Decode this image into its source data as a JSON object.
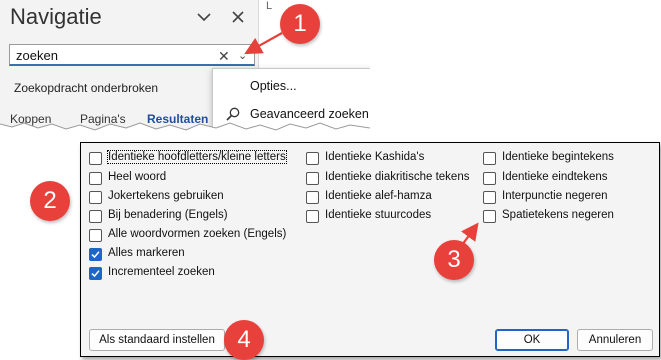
{
  "nav": {
    "title": "Navigatie",
    "ruler_mark": "L",
    "search_value": "zoeken",
    "status": "Zoekopdracht onderbroken",
    "tabs": [
      {
        "label": "Koppen"
      },
      {
        "label": "Pagina's"
      },
      {
        "label": "Resultaten",
        "active": true
      }
    ]
  },
  "menu": {
    "items": [
      {
        "label": "Opties..."
      },
      {
        "label": "Geavanceerd zoeken..."
      }
    ]
  },
  "dialog": {
    "options": [
      {
        "label": "Identieke hoofdletters/kleine letters",
        "checked": false
      },
      {
        "label": "Heel woord",
        "checked": false
      },
      {
        "label": "Jokertekens gebruiken",
        "checked": false
      },
      {
        "label": "Bij benadering (Engels)",
        "checked": false
      },
      {
        "label": "Alle woordvormen zoeken (Engels)",
        "checked": false
      },
      {
        "label": "Alles markeren",
        "checked": true
      },
      {
        "label": "Incrementeel zoeken",
        "checked": true
      },
      {
        "label": "Identieke Kashida's",
        "checked": false
      },
      {
        "label": "Identieke diakritische tekens",
        "checked": false
      },
      {
        "label": "Identieke alef-hamza",
        "checked": false
      },
      {
        "label": "Identieke stuurcodes",
        "checked": false
      },
      {
        "label": "Identieke begintekens",
        "checked": false
      },
      {
        "label": "Identieke eindtekens",
        "checked": false
      },
      {
        "label": "Interpunctie negeren",
        "checked": false
      },
      {
        "label": "Spatietekens negeren",
        "checked": false
      }
    ],
    "set_default_label": "Als standaard instellen",
    "ok_label": "OK",
    "cancel_label": "Annuleren"
  },
  "callouts": [
    "1",
    "2",
    "3",
    "4"
  ],
  "colors": {
    "callout": "#e8403b",
    "checkbox_checked": "#1f64c8",
    "active_tab": "#1e4e9c"
  },
  "icons": [
    "chevron-down-icon",
    "close-icon",
    "clear-icon",
    "dropdown-arrow-icon",
    "search-icon",
    "checkmark-icon"
  ]
}
